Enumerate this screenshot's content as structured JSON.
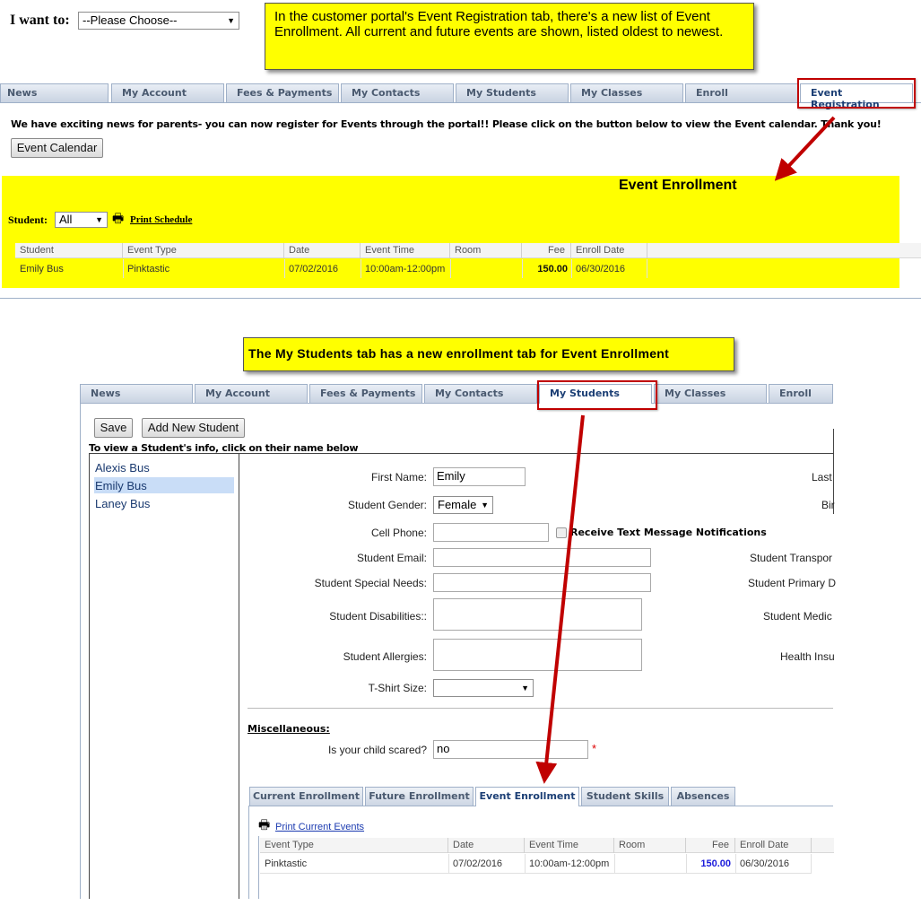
{
  "top": {
    "i_want_label": "I want to:",
    "i_want_value": "--Please Choose--"
  },
  "callouts": {
    "top": "In the customer portal's Event Registration tab, there's a new list of Event Enrollment. All current and future events are shown, listed oldest to newest.",
    "middle": "The My Students tab has a new enrollment tab for Event Enrollment"
  },
  "tabs_top": [
    "News",
    "My Account",
    "Fees & Payments",
    "My Contacts",
    "My Students",
    "My Classes",
    "Enroll",
    "Event Registration"
  ],
  "event_registration": {
    "notice": "We have exciting news for parents- you can now register for Events through the portal!! Please click on the button below to view the Event calendar. Thank you!",
    "calendar_button": "Event Calendar",
    "title": "Event Enrollment",
    "student_label": "Student:",
    "student_value": "All",
    "print_label": "Print Schedule",
    "columns": [
      "Student",
      "Event Type",
      "Date",
      "Event Time",
      "Room",
      "Fee",
      "Enroll Date"
    ],
    "rows": [
      {
        "student": "Emily Bus",
        "event_type": "Pinktastic",
        "date": "07/02/2016",
        "time": "10:00am-12:00pm",
        "room": "",
        "fee": "150.00",
        "enroll_date": "06/30/2016"
      }
    ]
  },
  "tabs_bottom": [
    "News",
    "My Account",
    "Fees & Payments",
    "My Contacts",
    "My Students",
    "My Classes",
    "Enroll"
  ],
  "students_page": {
    "save_button": "Save",
    "add_button": "Add New Student",
    "instructions": "To view a Student's info, click on their name below",
    "students": [
      "Alexis Bus",
      "Emily Bus",
      "Laney Bus"
    ],
    "labels": {
      "first_name": "First Name:",
      "gender": "Student Gender:",
      "cell_phone": "Cell Phone:",
      "text_notifications": "Receive Text Message Notifications",
      "email": "Student Email:",
      "special_needs": "Student Special Needs:",
      "disabilities": "Student Disabilities::",
      "allergies": "Student Allergies:",
      "tshirt": "T-Shirt Size:",
      "misc": "Miscellaneous:",
      "scared": "Is your child scared?"
    },
    "values": {
      "first_name": "Emily",
      "gender": "Female",
      "scared": "no",
      "required_mark": "*"
    },
    "right_labels": {
      "last": "Last",
      "birth": "Bir",
      "transport": "Student Transpor",
      "primary": "Student Primary D",
      "medical": "Student Medic",
      "insurance": "Health Insu"
    },
    "enroll_tabs": [
      "Current Enrollment",
      "Future Enrollment",
      "Event Enrollment",
      "Student Skills",
      "Absences"
    ],
    "print_events": "Print Current Events",
    "columns": [
      "Event Type",
      "Date",
      "Event Time",
      "Room",
      "Fee",
      "Enroll Date"
    ],
    "rows": [
      {
        "event_type": "Pinktastic",
        "date": "07/02/2016",
        "time": "10:00am-12:00pm",
        "room": "",
        "fee": "150.00",
        "enroll_date": "06/30/2016"
      }
    ]
  },
  "colors": {
    "highlight": "#ffff00",
    "annotation_red": "#c00000",
    "active_tab_text": "#1c3f75",
    "fee_blue": "#1a1adb",
    "selected_student": "#c9ddf7"
  }
}
